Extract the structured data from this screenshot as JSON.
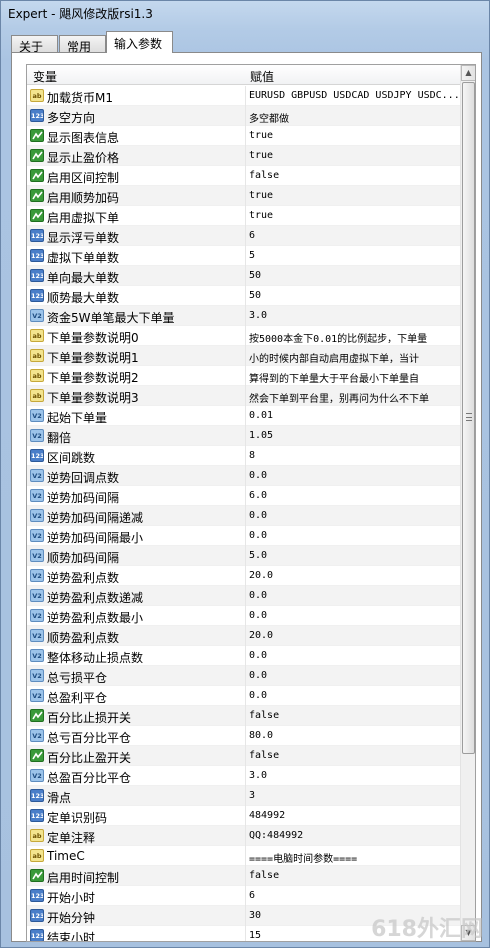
{
  "window": {
    "title": "Expert - 飓风修改版rsi1.3"
  },
  "tabs": [
    {
      "label": "关于"
    },
    {
      "label": "常用"
    },
    {
      "label": "输入参数"
    }
  ],
  "table": {
    "header_name": "变量",
    "header_value": "赋值",
    "rows": [
      {
        "type": "ab",
        "name": "加载货币M1",
        "value": "EURUSD GBPUSD USDCAD USDJPY USDC..."
      },
      {
        "type": "123",
        "name": "多空方向",
        "value": "多空都做"
      },
      {
        "type": "bool",
        "name": "显示图表信息",
        "value": "true"
      },
      {
        "type": "bool",
        "name": "显示止盈价格",
        "value": "true"
      },
      {
        "type": "bool",
        "name": "启用区间控制",
        "value": "false"
      },
      {
        "type": "bool",
        "name": "启用顺势加码",
        "value": "true"
      },
      {
        "type": "bool",
        "name": "启用虚拟下单",
        "value": "true"
      },
      {
        "type": "123",
        "name": "显示浮亏单数",
        "value": "6"
      },
      {
        "type": "123",
        "name": "虚拟下单单数",
        "value": "5"
      },
      {
        "type": "123",
        "name": "单向最大单数",
        "value": "50"
      },
      {
        "type": "123",
        "name": "顺势最大单数",
        "value": "50"
      },
      {
        "type": "v2",
        "name": "资金5W单笔最大下单量",
        "value": "3.0"
      },
      {
        "type": "ab",
        "name": "下单量参数说明0",
        "value": "按5000本金下0.01的比例起步，下单量"
      },
      {
        "type": "ab",
        "name": "下单量参数说明1",
        "value": "小的时候内部自动启用虚拟下单，当计"
      },
      {
        "type": "ab",
        "name": "下单量参数说明2",
        "value": "算得到的下单量大于平台最小下单量自"
      },
      {
        "type": "ab",
        "name": "下单量参数说明3",
        "value": "然会下单到平台里，别再问为什么不下单"
      },
      {
        "type": "v2",
        "name": "起始下单量",
        "value": "0.01"
      },
      {
        "type": "v2",
        "name": "翻倍",
        "value": "1.05"
      },
      {
        "type": "123",
        "name": "区间跳数",
        "value": "8"
      },
      {
        "type": "v2",
        "name": "逆势回调点数",
        "value": "0.0"
      },
      {
        "type": "v2",
        "name": "逆势加码间隔",
        "value": "6.0"
      },
      {
        "type": "v2",
        "name": "逆势加码间隔递减",
        "value": "0.0"
      },
      {
        "type": "v2",
        "name": "逆势加码间隔最小",
        "value": "0.0"
      },
      {
        "type": "v2",
        "name": "顺势加码间隔",
        "value": "5.0"
      },
      {
        "type": "v2",
        "name": "逆势盈利点数",
        "value": "20.0"
      },
      {
        "type": "v2",
        "name": "逆势盈利点数递减",
        "value": "0.0"
      },
      {
        "type": "v2",
        "name": "逆势盈利点数最小",
        "value": "0.0"
      },
      {
        "type": "v2",
        "name": "顺势盈利点数",
        "value": "20.0"
      },
      {
        "type": "v2",
        "name": "整体移动止损点数",
        "value": "0.0"
      },
      {
        "type": "v2",
        "name": "总亏损平仓",
        "value": "0.0"
      },
      {
        "type": "v2",
        "name": "总盈利平仓",
        "value": "0.0"
      },
      {
        "type": "bool",
        "name": "百分比止损开关",
        "value": "false"
      },
      {
        "type": "v2",
        "name": "总亏百分比平仓",
        "value": "80.0"
      },
      {
        "type": "bool",
        "name": "百分比止盈开关",
        "value": "false"
      },
      {
        "type": "v2",
        "name": "总盈百分比平仓",
        "value": "3.0"
      },
      {
        "type": "123",
        "name": "滑点",
        "value": "3"
      },
      {
        "type": "123",
        "name": "定单识别码",
        "value": "484992"
      },
      {
        "type": "ab",
        "name": "定单注释",
        "value": "QQ:484992"
      },
      {
        "type": "ab",
        "name": "TimeC",
        "value": "====电脑时间参数===="
      },
      {
        "type": "bool",
        "name": "启用时间控制",
        "value": "false"
      },
      {
        "type": "123",
        "name": "开始小时",
        "value": "6"
      },
      {
        "type": "123",
        "name": "开始分钟",
        "value": "30"
      },
      {
        "type": "123",
        "name": "结束小时",
        "value": "15"
      }
    ]
  },
  "icon_labels": {
    "ab": "ab",
    "123": "123",
    "v2": "V2"
  },
  "watermark": "618外汇网"
}
